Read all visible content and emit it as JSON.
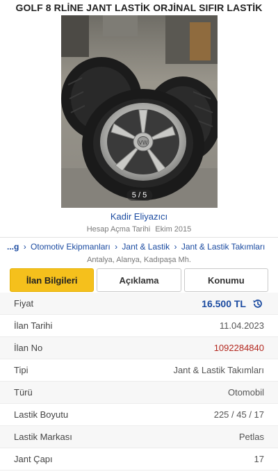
{
  "listing": {
    "title": "GOLF 8 RLİNE JANT LASTİK ORJİNAL SIFIR LASTİK",
    "photo_counter": "5 / 5"
  },
  "seller": {
    "name": "Kadir Eliyazıcı",
    "since_label": "Hesap Açma Tarihi",
    "since_value": "Ekim 2015"
  },
  "breadcrumb": {
    "first": "...g",
    "items": [
      "Otomotiv Ekipmanları",
      "Jant & Lastik",
      "Jant & Lastik Takımları"
    ]
  },
  "location": "Antalya, Alanya, Kadıpaşa Mh.",
  "tabs": [
    {
      "label": "İlan Bilgileri",
      "active": true
    },
    {
      "label": "Açıklama",
      "active": false
    },
    {
      "label": "Konumu",
      "active": false
    }
  ],
  "details": [
    {
      "label": "Fiyat",
      "value": "16.500 TL"
    },
    {
      "label": "İlan Tarihi",
      "value": "11.04.2023"
    },
    {
      "label": "İlan No",
      "value": "1092284840"
    },
    {
      "label": "Tipi",
      "value": "Jant & Lastik Takımları"
    },
    {
      "label": "Türü",
      "value": "Otomobil"
    },
    {
      "label": "Lastik Boyutu",
      "value": "225 / 45 / 17"
    },
    {
      "label": "Lastik Markası",
      "value": "Petlas"
    },
    {
      "label": "Jant Çapı",
      "value": "17"
    }
  ],
  "colors": {
    "accent_tab": "#f5c01c",
    "link": "#1a4aa0",
    "listing_id": "#b3271e"
  }
}
